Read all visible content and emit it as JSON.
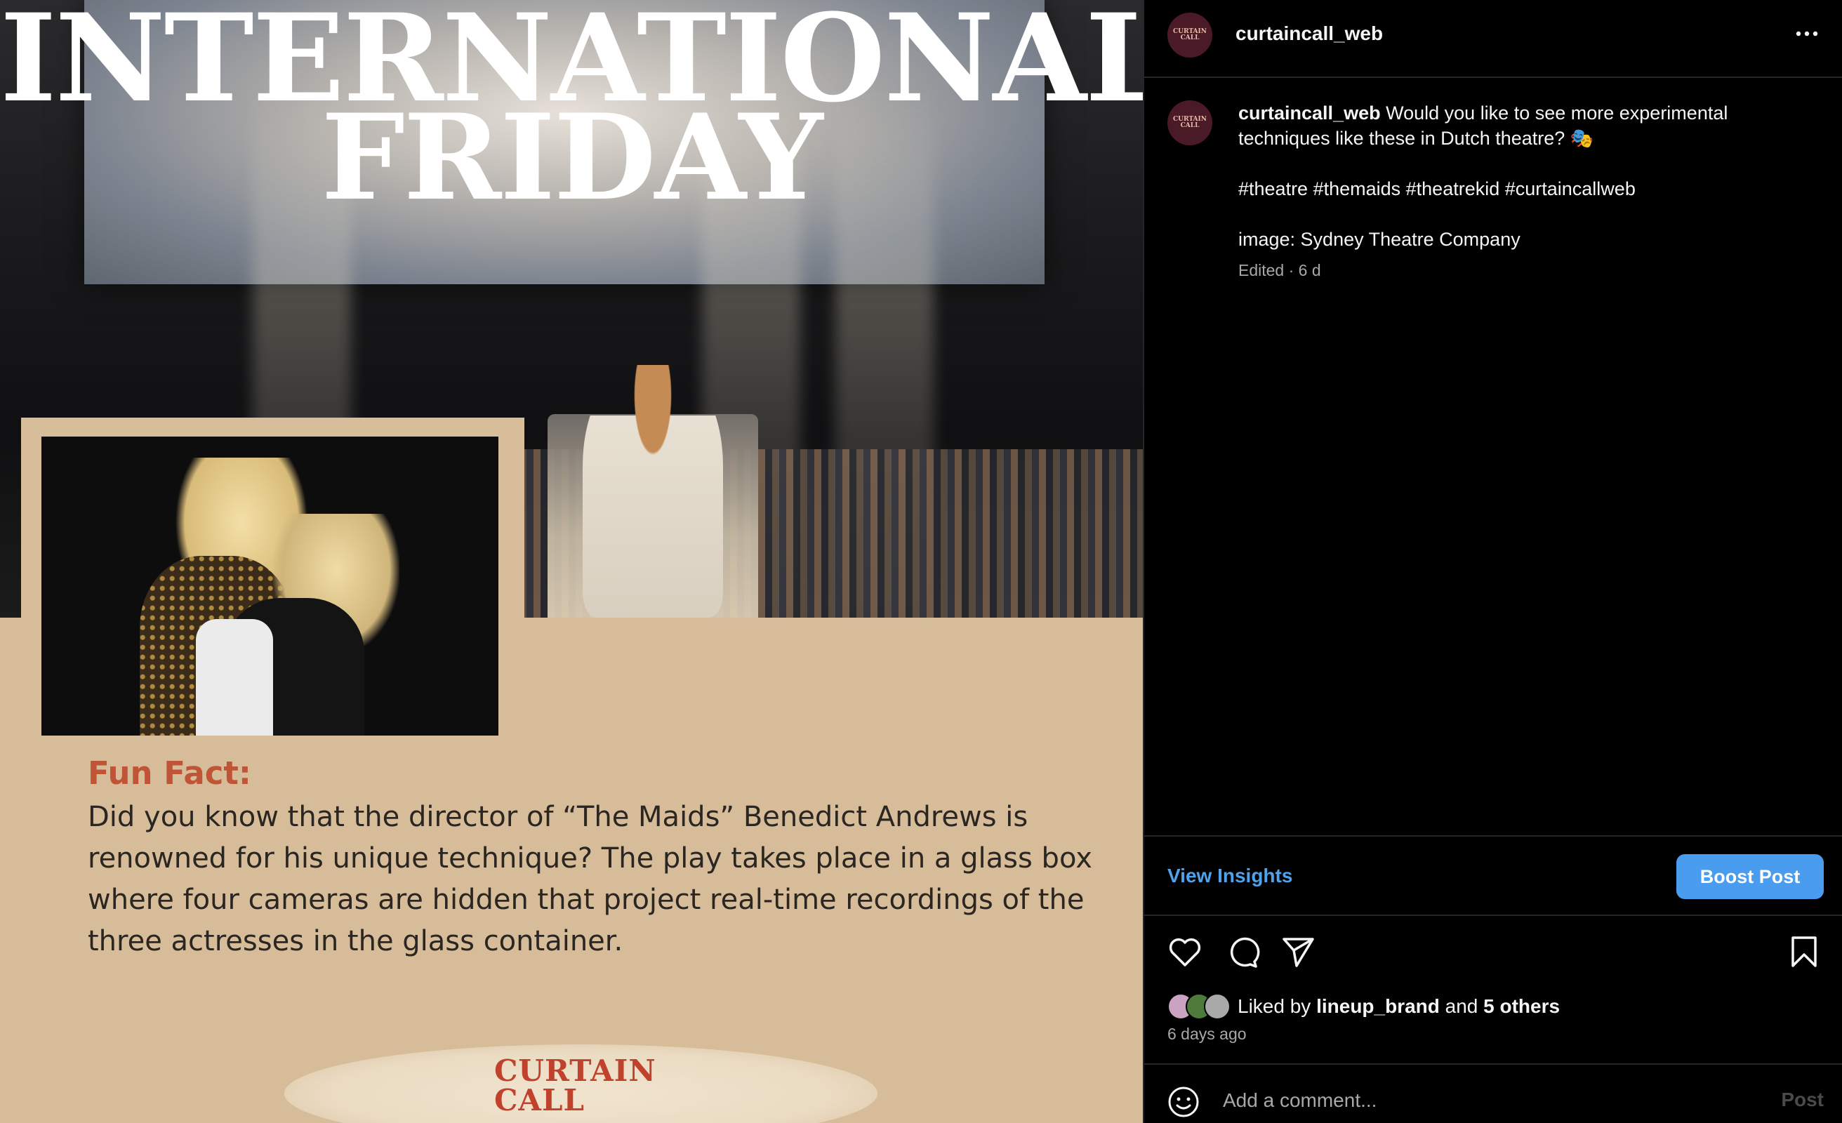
{
  "post_image": {
    "title_line1": "INTERNATIONAL",
    "title_line2": "FRIDAY",
    "fun_fact_heading": "Fun Fact:",
    "fun_fact_body": "Did you know that the director of “The Maids” Benedict Andrews is renowned for his unique technique? The play takes place in a glass box where four cameras are hidden that project real-time recordings of the three actresses in the glass container.",
    "logo_line1": "CURTAIN",
    "logo_line2": "CALL"
  },
  "header": {
    "username": "curtaincall_web",
    "avatar_text": "CURTAIN CALL",
    "more_icon": "more-horizontal-icon"
  },
  "caption": {
    "username": "curtaincall_web",
    "text": "Would you like to see more experimental techniques like these in Dutch theatre? 🎭",
    "hashtags": "#theatre #themaids #theatrekid #curtaincallweb",
    "credit": "image: Sydney Theatre Company",
    "meta": "Edited · 6 d"
  },
  "insights": {
    "view_insights_label": "View Insights",
    "boost_label": "Boost Post"
  },
  "actions": {
    "icons": [
      "heart-icon",
      "comment-icon",
      "share-icon",
      "bookmark-icon"
    ]
  },
  "likes": {
    "prefix": "Liked by",
    "first_user": "lineup_brand",
    "joiner": "and",
    "others": "5 others",
    "time_ago": "6 days ago"
  },
  "comment": {
    "placeholder": "Add a comment...",
    "post_label": "Post"
  },
  "colors": {
    "accent_blue": "#4a9cee",
    "link_blue": "#4fa3ec",
    "fun_fact_orange": "#bf5436",
    "beige": "#d6bc99",
    "background": "#000000"
  }
}
